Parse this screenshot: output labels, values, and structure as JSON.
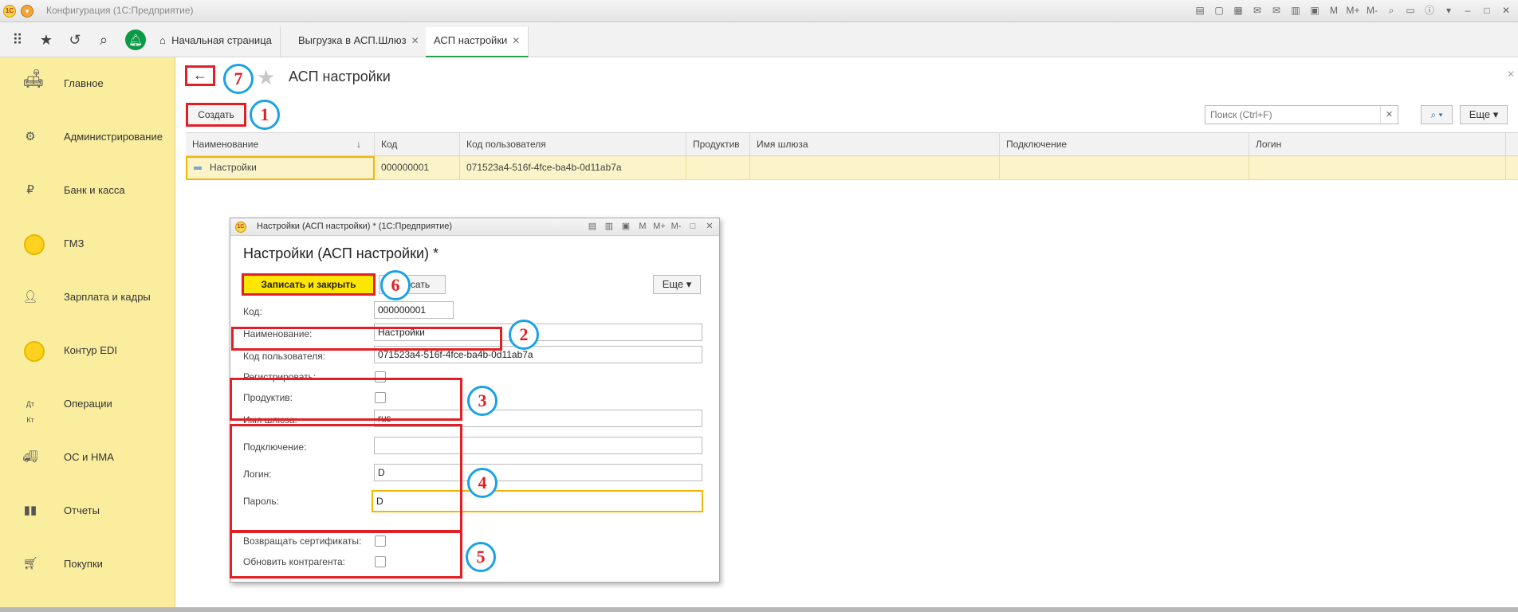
{
  "window": {
    "title": "Конфигурация  (1С:Предприятие)",
    "logo_text": "1С"
  },
  "titlebar_icons": [
    "M",
    "M+",
    "M-"
  ],
  "tabs": [
    {
      "label": "Начальная страница"
    },
    {
      "label": "Выгрузка в АСП.Шлюз"
    },
    {
      "label": "АСП настройки"
    }
  ],
  "sidebar": {
    "items": [
      {
        "label": "Главное"
      },
      {
        "label": "Администрирование"
      },
      {
        "label": "Банк и касса"
      },
      {
        "label": "ГМЗ"
      },
      {
        "label": "Зарплата и кадры"
      },
      {
        "label": "Контур EDI"
      },
      {
        "label": "Операции"
      },
      {
        "label": "ОС и НМА"
      },
      {
        "label": "Отчеты"
      },
      {
        "label": "Покупки"
      }
    ]
  },
  "main": {
    "title": "АСП настройки",
    "create_label": "Создать",
    "search_placeholder": "Поиск (Ctrl+F)",
    "more_label": "Еще",
    "columns": [
      "Наименование",
      "Код",
      "Код пользователя",
      "Продуктив",
      "Имя шлюза",
      "Подключение",
      "Логин"
    ],
    "rows": [
      [
        "Настройки",
        "000000001",
        "071523a4-516f-4fce-ba4b-0d11ab7a",
        "",
        "",
        "",
        ""
      ]
    ]
  },
  "dialog": {
    "window_title": "Настройки (АСП настройки) * (1С:Предприятие)",
    "heading": "Настройки (АСП настройки) *",
    "save_close_label": "Записать и закрыть",
    "write_label": "сать",
    "more_label": "Еще",
    "title_icons": [
      "M",
      "M+",
      "M-"
    ],
    "fields": {
      "code": {
        "label": "Код:",
        "value": "000000001"
      },
      "name": {
        "label": "Наименование:",
        "value": "Настройки"
      },
      "user_code": {
        "label": "Код пользователя:",
        "value": "071523a4-516f-4fce-ba4b-0d11ab7a"
      },
      "register": {
        "label": "Регистрировать:"
      },
      "productive": {
        "label": "Продуктив:"
      },
      "gateway": {
        "label": "Имя шлюза:",
        "value": "rus"
      },
      "connection": {
        "label": "Подключение:",
        "value": ""
      },
      "login": {
        "label": "Логин:",
        "value": "D"
      },
      "password": {
        "label": "Пароль:",
        "value": "D"
      },
      "return_certs": {
        "label": "Возвращать сертификаты:"
      },
      "update_contractor": {
        "label": "Обновить контрагента:"
      }
    }
  },
  "annotations": [
    "1",
    "2",
    "3",
    "4",
    "5",
    "6",
    "7"
  ],
  "colors": {
    "sidebar_bg": "#fbed9e",
    "annotation_red": "#e31e24",
    "annotation_blue": "#1ba1e6",
    "accent_green": "#0b9a47",
    "primary_yellow": "#ffe600"
  }
}
